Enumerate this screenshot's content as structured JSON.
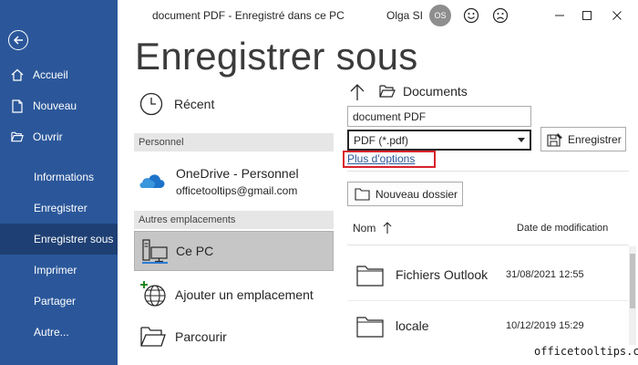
{
  "titlebar": {
    "doc_title": "document PDF  -  Enregistré dans ce PC",
    "user_name": "Olga SI",
    "avatar_initials": "OS",
    "icons": [
      "smiley-icon",
      "frown-icon",
      "minimize-icon",
      "maximize-icon",
      "close-icon"
    ]
  },
  "sidebar": {
    "bg_color": "#2b579a",
    "items": [
      {
        "label": "Accueil",
        "icon": "home-icon"
      },
      {
        "label": "Nouveau",
        "icon": "new-doc-icon"
      },
      {
        "label": "Ouvrir",
        "icon": "open-folder-icon"
      },
      {
        "label": "Informations"
      },
      {
        "label": "Enregistrer"
      },
      {
        "label": "Enregistrer sous",
        "active": true
      },
      {
        "label": "Imprimer"
      },
      {
        "label": "Partager"
      },
      {
        "label": "Autre..."
      }
    ]
  },
  "page_title": "Enregistrer sous",
  "locations": {
    "recent_label": "Récent",
    "personal_header": "Personnel",
    "onedrive_name": "OneDrive - Personnel",
    "onedrive_email": "officetooltips@gmail.com",
    "other_header": "Autres emplacements",
    "this_pc_label": "Ce PC",
    "add_location_label": "Ajouter un emplacement",
    "browse_label": "Parcourir"
  },
  "save_panel": {
    "path_label": "Documents",
    "file_name_value": "document PDF",
    "file_type_value": "PDF (*.pdf)",
    "save_button_label": "Enregistrer",
    "more_options_label": "Plus d'options",
    "new_folder_label": "Nouveau dossier",
    "col_name": "Nom",
    "col_date": "Date de modification",
    "files": [
      {
        "name": "Fichiers Outlook",
        "date": "31/08/2021 12:55"
      },
      {
        "name": "locale",
        "date": "10/12/2019 15:29"
      }
    ]
  },
  "watermark": "officetooltips.com",
  "colors": {
    "accent": "#2b579a",
    "highlight": "#d9232d",
    "selected": "#c6c6c6"
  }
}
